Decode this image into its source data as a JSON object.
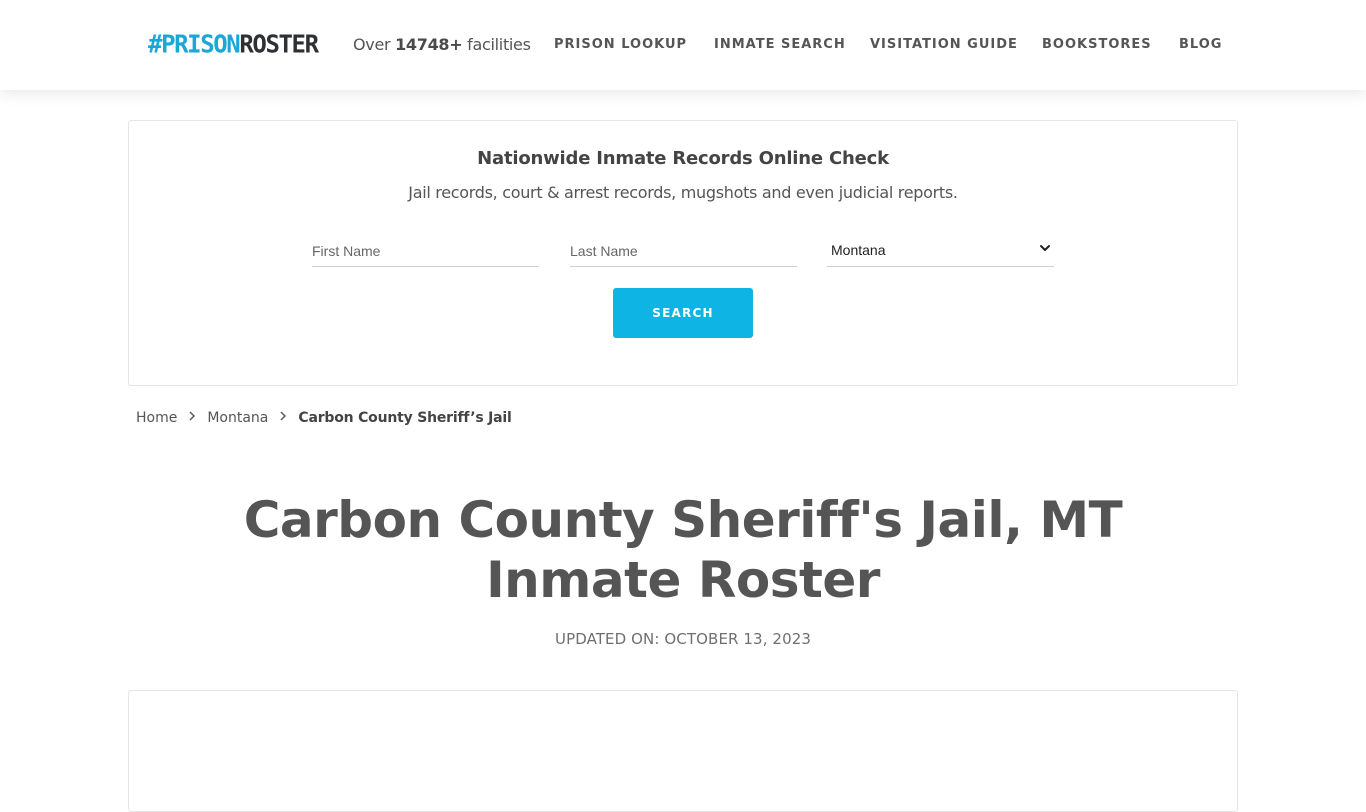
{
  "header": {
    "logo_hash": "#",
    "logo_prison": "PRISON",
    "logo_roster": "ROSTER",
    "facilities_prefix": "Over",
    "facilities_count": "14748+",
    "facilities_suffix": "facilities",
    "nav": [
      {
        "label": "PRISON LOOKUP"
      },
      {
        "label": "INMATE SEARCH"
      },
      {
        "label": "VISITATION GUIDE"
      },
      {
        "label": "BOOKSTORES"
      },
      {
        "label": "BLOG"
      }
    ]
  },
  "search": {
    "title": "Nationwide Inmate Records Online Check",
    "subtitle": "Jail records, court & arrest records, mugshots and even judicial reports.",
    "first_name_placeholder": "First Name",
    "last_name_placeholder": "Last Name",
    "state_selected": "Montana",
    "button_label": "SEARCH",
    "accent_color": "#0eb4e4"
  },
  "breadcrumb": {
    "home": "Home",
    "state": "Montana",
    "current": "Carbon County Sheriff’s Jail"
  },
  "page": {
    "title_line1": "Carbon County Sheriff's Jail, MT",
    "title_line2": "Inmate Roster",
    "updated": "UPDATED ON: OCTOBER 13, 2023"
  },
  "icons": {
    "chevron": "chevron-right-icon",
    "select": "chevron-down-icon"
  }
}
